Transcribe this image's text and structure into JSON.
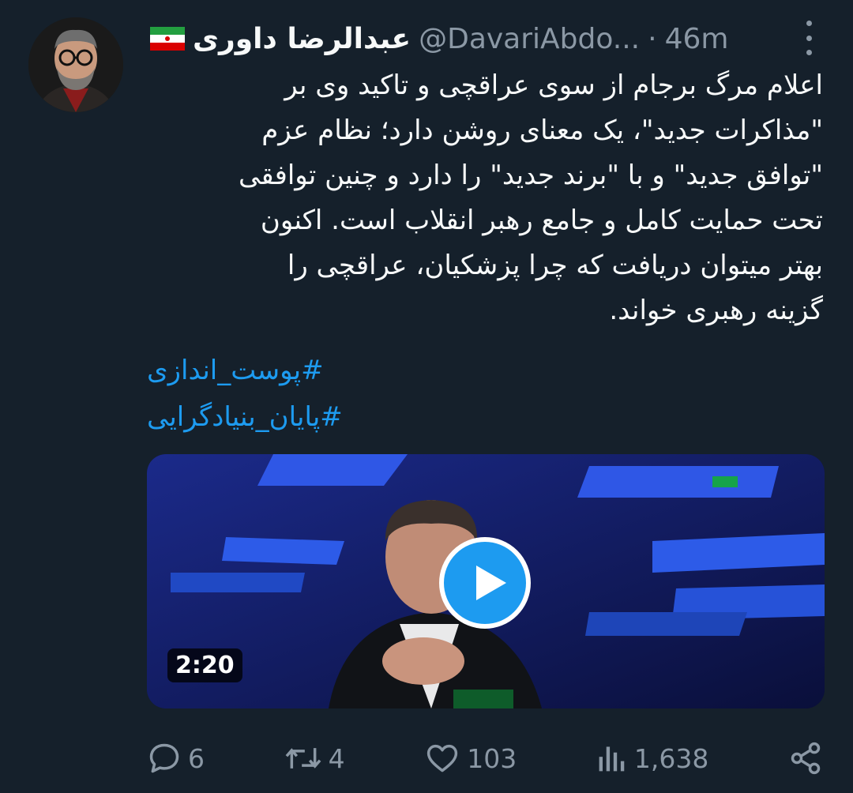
{
  "tweet": {
    "display_name": "عبدالرضا داوری",
    "handle": "@DavariAbdo...",
    "separator": "·",
    "time": "46m",
    "body": "اعلام مرگ برجام از سوی عراقچی و تاکید وی بر\n\"مذاکرات جدید\"، یک معنای روشن دارد؛ نظام عزم\n\"توافق جدید\" و با \"برند جدید\" را دارد و چنین توافقی\nتحت حمایت کامل و جامع رهبر انقلاب است. اکنون\nبهتر میتوان دریافت که چرا پزشکیان، عراقچی را\nگزینه رهبری خواند.",
    "hashtags": [
      "#پوست_اندازی",
      "#پایان_بنیادگرایی"
    ]
  },
  "media": {
    "duration": "2:20"
  },
  "actions": {
    "replies": "6",
    "retweets": "4",
    "likes": "103",
    "views": "1,638"
  },
  "colors": {
    "background": "#15202b",
    "accent": "#1d9bf0",
    "muted": "#8b98a5"
  },
  "icons": [
    "flag-of-iran-icon",
    "more-icon",
    "reply-icon",
    "retweet-icon",
    "like-icon",
    "views-icon",
    "share-icon",
    "play-icon"
  ]
}
